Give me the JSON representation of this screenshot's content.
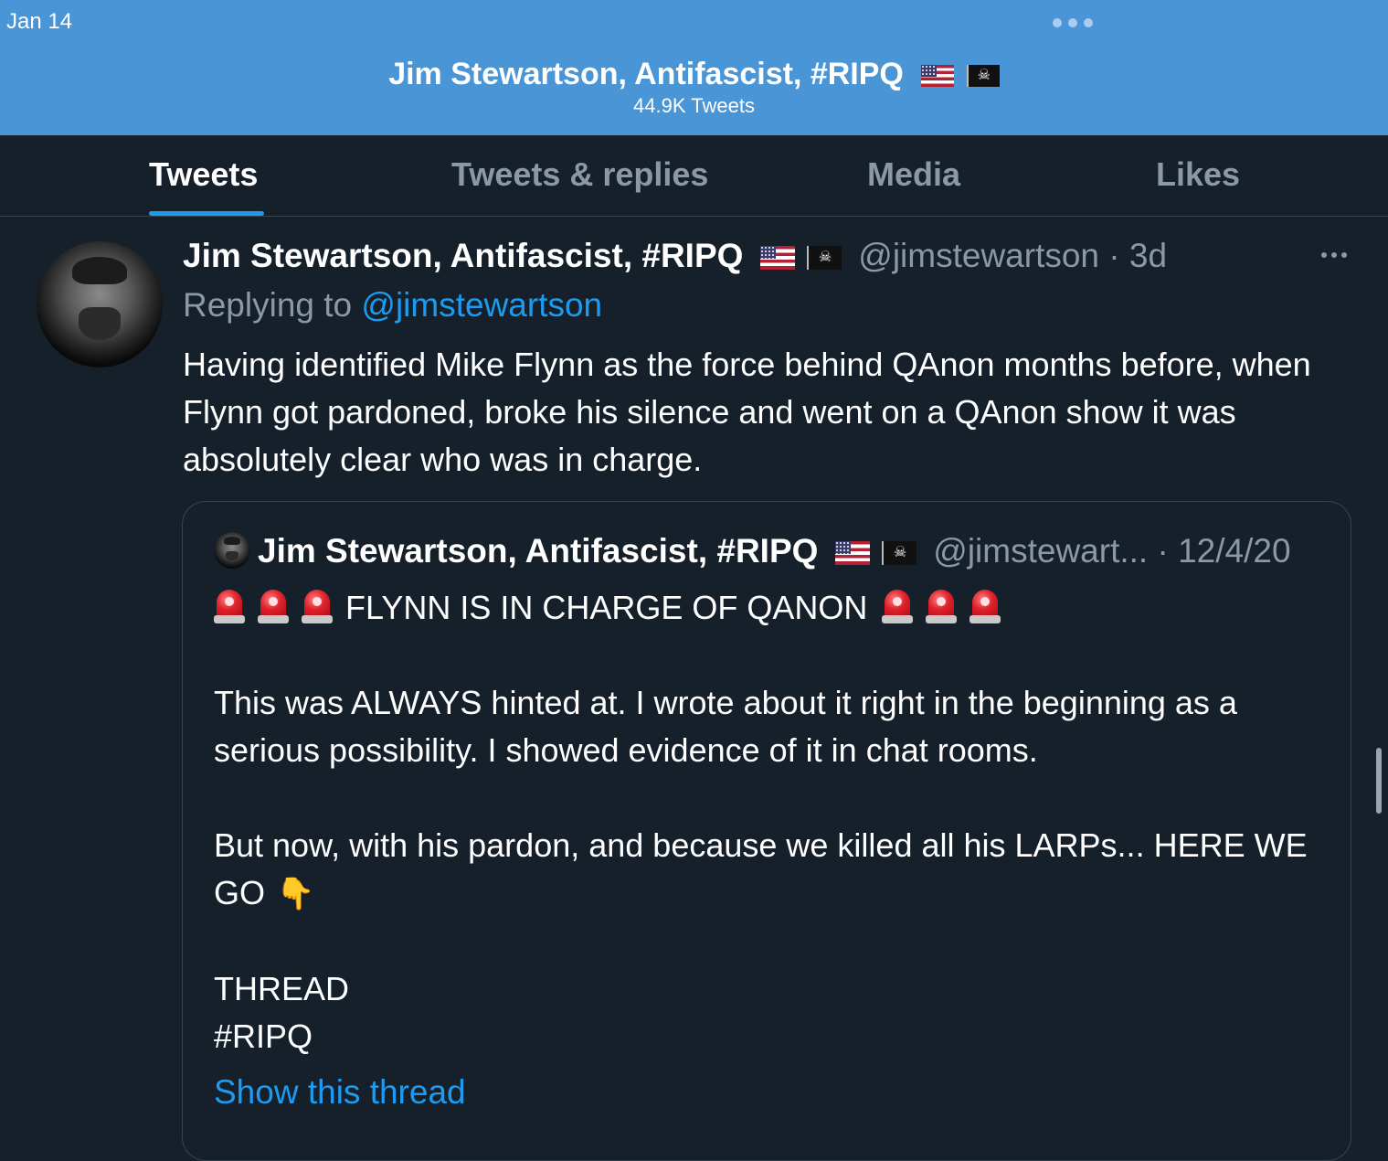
{
  "status_bar": {
    "date": "Jan 14"
  },
  "profile_header": {
    "name": "Jim Stewartson, Antifascist, #RIPQ",
    "tweet_count": "44.9K Tweets"
  },
  "tabs": [
    {
      "label": "Tweets",
      "active": true
    },
    {
      "label": "Tweets & replies",
      "active": false
    },
    {
      "label": "Media",
      "active": false
    },
    {
      "label": "Likes",
      "active": false
    }
  ],
  "tweet": {
    "author": "Jim Stewartson, Antifascist, #RIPQ",
    "handle": "@jimstewartson",
    "separator": "·",
    "time": "3d",
    "replying_prefix": "Replying to",
    "replying_to": "@jimstewartson",
    "text": "Having identified Mike Flynn as the force behind QAnon months before, when Flynn got pardoned, broke his silence and went on a QAnon show it was absolutely clear who was in charge."
  },
  "quoted_tweet": {
    "author": "Jim Stewartson, Antifascist, #RIPQ",
    "handle": "@jimstewart...",
    "separator": "·",
    "time": "12/4/20",
    "headline": "FLYNN IS IN CHARGE OF QANON",
    "paragraph1": "This was ALWAYS hinted at. I wrote about it right in the beginning as a serious possibility. I showed evidence of it in chat rooms.",
    "paragraph2": "But now, with his pardon, and because we killed all his LARPs... HERE WE GO",
    "thread_label": "THREAD",
    "hashtag": "#RIPQ",
    "show_thread": "Show this thread"
  },
  "icons": {
    "flags": [
      "us-flag-icon",
      "pirate-flag-icon"
    ],
    "siren": "police-light-icon",
    "pointing_down": "pointing-down-icon",
    "more": "more-options-icon"
  },
  "colors": {
    "header_bg": "#4a95d6",
    "page_bg": "#15202b",
    "accent": "#1d9bf0",
    "muted_text": "#8b98a5",
    "border": "#38444d"
  }
}
